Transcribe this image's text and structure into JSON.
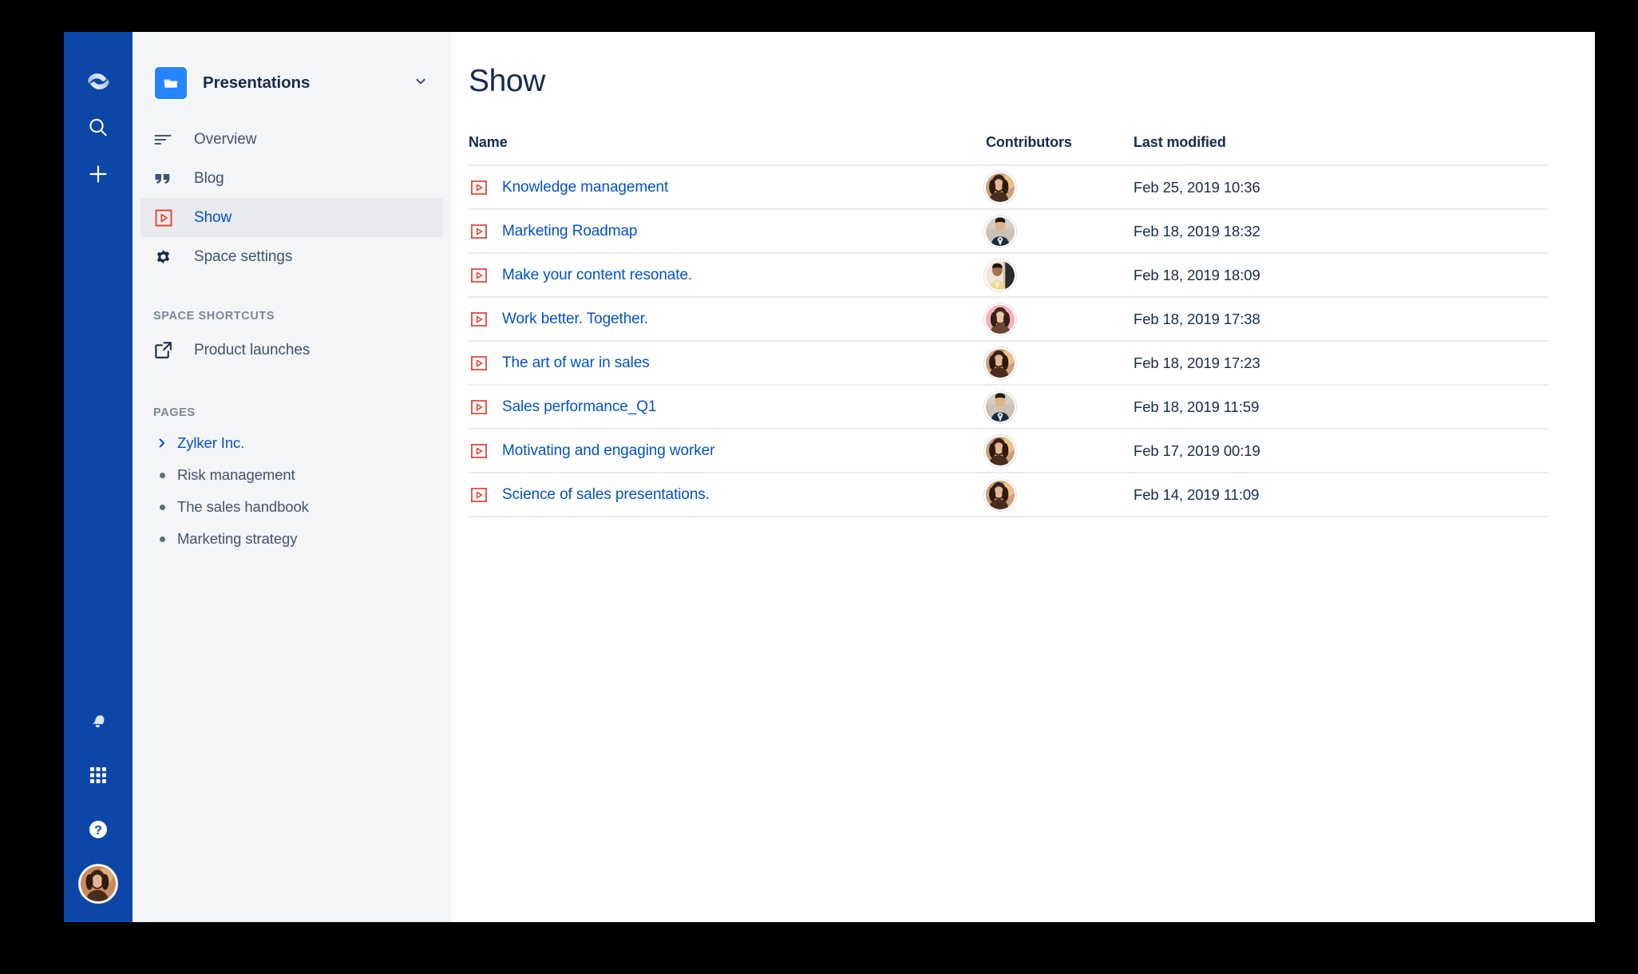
{
  "global_rail": {
    "top_items": [
      {
        "name": "confluence-logo-icon",
        "label": "Confluence"
      },
      {
        "name": "search-icon",
        "label": "Search"
      },
      {
        "name": "create-icon",
        "label": "Create"
      }
    ],
    "bottom_items": [
      {
        "name": "notifications-bell-icon",
        "label": "Notifications"
      },
      {
        "name": "app-switcher-grid-icon",
        "label": "App switcher"
      },
      {
        "name": "help-question-icon",
        "label": "Help"
      },
      {
        "name": "user-avatar",
        "label": "Your profile"
      }
    ]
  },
  "space": {
    "title": "Presentations",
    "logo_color": "#2684ff",
    "nav": [
      {
        "label": "Overview",
        "icon": "overview-lines-icon",
        "selected": false
      },
      {
        "label": "Blog",
        "icon": "blog-quote-icon",
        "selected": false
      },
      {
        "label": "Show",
        "icon": "presentation-show-icon",
        "selected": true
      },
      {
        "label": "Space settings",
        "icon": "gear-icon",
        "selected": false
      }
    ],
    "shortcuts_heading": "SPACE SHORTCUTS",
    "shortcuts": [
      {
        "label": "Product launches",
        "icon": "external-link-icon"
      }
    ],
    "pages_heading": "PAGES",
    "pages": [
      {
        "label": "Zylker Inc.",
        "bullet": "chevron-right-icon",
        "link": true
      },
      {
        "label": "Risk management",
        "bullet": "dot",
        "link": false
      },
      {
        "label": "The sales handbook",
        "bullet": "dot",
        "link": false
      },
      {
        "label": "Marketing strategy",
        "bullet": "dot",
        "link": false
      }
    ]
  },
  "main": {
    "title": "Show",
    "table": {
      "columns": [
        "Name",
        "Contributors",
        "Last modified"
      ],
      "rows": [
        {
          "name": "Knowledge management",
          "avatar": "woman-warm",
          "modified": "Feb 25, 2019 10:36"
        },
        {
          "name": "Marketing Roadmap",
          "avatar": "man-suit",
          "modified": "Feb 18, 2019 18:32"
        },
        {
          "name": "Make your content resonate.",
          "avatar": "person-door",
          "modified": "Feb 18, 2019 18:09"
        },
        {
          "name": "Work better. Together.",
          "avatar": "woman-pink",
          "modified": "Feb 18, 2019 17:38"
        },
        {
          "name": "The art of war in sales",
          "avatar": "woman-warm",
          "modified": "Feb 18, 2019 17:23"
        },
        {
          "name": "Sales performance_Q1",
          "avatar": "man-suit",
          "modified": "Feb 18, 2019 11:59"
        },
        {
          "name": "Motivating and engaging worker",
          "avatar": "woman-warm",
          "modified": "Feb 17, 2019 00:19"
        },
        {
          "name": "Science of sales presentations.",
          "avatar": "woman-warm",
          "modified": "Feb 14, 2019 11:09"
        }
      ]
    }
  },
  "colors": {
    "rail_blue": "#0c47a7",
    "sidebar_gray": "#f4f5f7",
    "link_blue": "#0052cc",
    "icon_red": "#e34935",
    "text_dark": "#172b4d",
    "text_muted": "#7a869a",
    "row_border": "#ebecf0",
    "selected_bg": "#e9eaee"
  }
}
